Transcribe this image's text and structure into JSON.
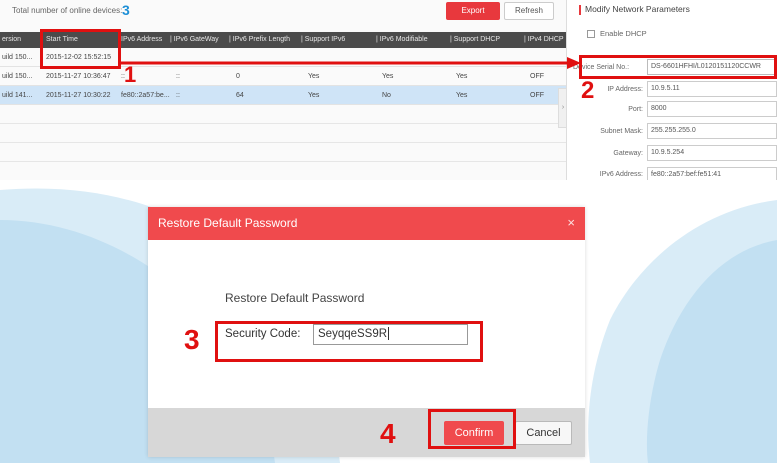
{
  "device_list": {
    "online_label": "Total number of online devices:",
    "online_count": "3",
    "export_label": "Export",
    "refresh_label": "Refresh",
    "columns": [
      "ersion",
      "Start Time",
      "IPv6 Address",
      "| IPv6 GateWay",
      "| IPv6 Prefix Length",
      "| Support IPv6",
      "| IPv6 Modifiable",
      "| Support DHCP",
      "| IPv4 DHCP"
    ],
    "rows": [
      [
        "uild 150...",
        "2015-12-02 15:52:15",
        "",
        "",
        "",
        "",
        "",
        "",
        ""
      ],
      [
        "uild 150...",
        "2015-11-27 10:36:47",
        "::",
        "::",
        "0",
        "Yes",
        "Yes",
        "Yes",
        "OFF"
      ],
      [
        "uild 141...",
        "2015-11-27 10:30:22",
        "fe80::2a57:be...",
        "::",
        "64",
        "Yes",
        "No",
        "Yes",
        "OFF"
      ]
    ]
  },
  "modify_panel": {
    "title": "Modify Network Parameters",
    "enable_dhcp_label": "Enable DHCP",
    "fields": [
      {
        "label": "Device Serial No.:",
        "value": "DS-6601HFHI/L0120151120CCWR"
      },
      {
        "label": "IP Address:",
        "value": "10.9.5.11"
      },
      {
        "label": "Port:",
        "value": "8000"
      },
      {
        "label": "Subnet Mask:",
        "value": "255.255.255.0"
      },
      {
        "label": "Gateway:",
        "value": "10.9.5.254"
      },
      {
        "label": "IPv6 Address:",
        "value": "fe80::2a57:bef:fe51:41"
      }
    ]
  },
  "dialog": {
    "title": "Restore Default Password",
    "close_glyph": "×",
    "heading": "Restore Default Password",
    "security_code_label": "Security Code:",
    "security_code_value": "SeyqqeSS9R",
    "confirm_label": "Confirm",
    "cancel_label": "Cancel"
  },
  "annotations": {
    "step1": "1",
    "step2": "2",
    "step3": "3",
    "step4": "4",
    "color": "#e01010"
  },
  "colors": {
    "accent": "#f04a4d",
    "header_bar": "#4b4b4b",
    "selected_row": "#cfe4f7",
    "count_blue": "#1e8fd6"
  }
}
